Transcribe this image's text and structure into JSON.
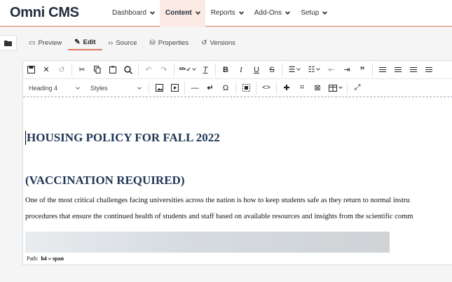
{
  "app": {
    "logo": "Omni CMS"
  },
  "nav": [
    {
      "label": "Dashboard",
      "active": false
    },
    {
      "label": "Content",
      "active": true
    },
    {
      "label": "Reports",
      "active": false
    },
    {
      "label": "Add-Ons",
      "active": false
    },
    {
      "label": "Setup",
      "active": false
    }
  ],
  "tabs": [
    {
      "label": "Preview",
      "icon": "monitor-icon",
      "glyph": "▭"
    },
    {
      "label": "Edit",
      "icon": "pencil-icon",
      "glyph": "✎"
    },
    {
      "label": "Source",
      "icon": "code-icon",
      "glyph": "‹›"
    },
    {
      "label": "Properties",
      "icon": "properties-icon",
      "glyph": "⛁"
    },
    {
      "label": "Versions",
      "icon": "history-icon",
      "glyph": "↺"
    }
  ],
  "toolbar": {
    "format_select": "Heading 4",
    "styles_select": "Styles"
  },
  "document": {
    "heading": "HOUSING POLICY FOR FALL 2022",
    "subheading": "(VACCINATION REQUIRED)",
    "paragraph_line1": "One of the most critical challenges facing universities across the nation is how to keep students safe as they return to normal instru",
    "paragraph_line2": "procedures that ensure the continued health of students and staff based on available resources and insights from the scientific comm"
  },
  "statusbar": {
    "path_label": "Path:",
    "path_value": "h4 » span"
  },
  "colors": {
    "accent": "#e07a5f",
    "heading": "#1f3554"
  }
}
